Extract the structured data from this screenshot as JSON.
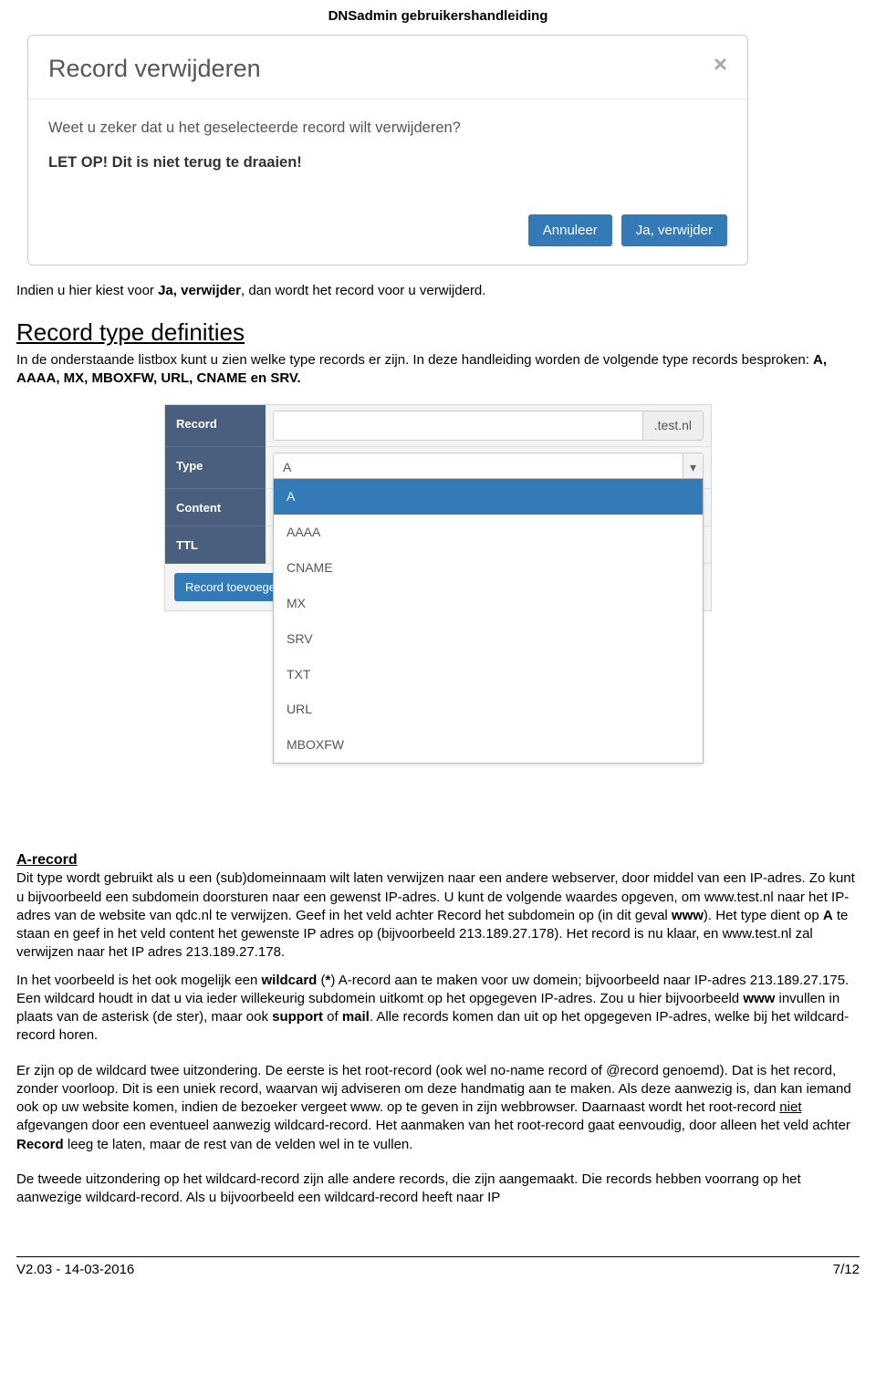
{
  "header": {
    "title": "DNSadmin gebruikershandleiding"
  },
  "modal": {
    "title": "Record verwijderen",
    "close": "×",
    "message": "Weet u zeker dat u het geselecteerde record wilt verwijderen?",
    "warning": "LET OP! Dit is niet terug te draaien!",
    "cancel": "Annuleer",
    "confirm": "Ja, verwijder"
  },
  "text": {
    "after_modal_pre": "Indien u hier kiest voor ",
    "after_modal_bold": "Ja, verwijder",
    "after_modal_post": ", dan wordt het record voor u verwijderd.",
    "section_title": "Record type definities",
    "section_intro_pre": "In de onderstaande listbox kunt u zien welke type records er zijn. In deze handleiding worden de volgende type records besproken: ",
    "section_intro_bold": "A, AAAA, MX, MBOXFW, URL, CNAME en SRV.",
    "a_heading": "A-record",
    "a_p1_a": "Dit type wordt gebruikt als u een (sub)domeinnaam wilt laten verwijzen naar een andere webserver, door middel van een IP-adres. Zo kunt u bijvoorbeeld een subdomein doorsturen naar een gewenst IP-adres. U kunt de volgende waardes opgeven, om www.test.nl naar het IP-adres van de website van qdc.nl te verwijzen. Geef in het veld achter Record het subdomein op (in dit geval ",
    "a_p1_b": "www",
    "a_p1_c": "). Het type dient op ",
    "a_p1_d": "A",
    "a_p1_e": " te staan en geef in het veld content het gewenste IP adres op (bijvoorbeeld 213.189.27.178). Het record is nu klaar, en www.test.nl zal verwijzen naar het IP adres 213.189.27.178.",
    "a_p2_a": "In het voorbeeld is het ook mogelijk een ",
    "a_p2_b": "wildcard",
    "a_p2_c": " (",
    "a_p2_d": "*",
    "a_p2_e": ") A-record aan te maken voor uw domein; bijvoorbeeld naar IP-adres 213.189.27.175. Een wildcard houdt in dat u via ieder willekeurig subdomein uitkomt op het opgegeven IP-adres. Zou u hier bijvoorbeeld ",
    "a_p2_f": "www",
    "a_p2_g": " invullen in plaats van de asterisk (de ster), maar ook ",
    "a_p2_h": "support",
    "a_p2_i": " of ",
    "a_p2_j": "mail",
    "a_p2_k": ". Alle records komen dan uit op het opgegeven IP-adres, welke bij het wildcard-record horen.",
    "a_p3_a": "Er zijn op de wildcard twee uitzondering. De eerste is het root-record (ook wel no-name record of @record genoemd). Dat is het record, zonder voorloop. Dit is een uniek record, waarvan wij adviseren om deze handmatig aan te maken. Als deze aanwezig is, dan kan iemand ook op uw website komen, indien de bezoeker vergeet www. op te geven in zijn webbrowser. Daarnaast wordt het root-record ",
    "a_p3_b": "niet",
    "a_p3_c": " afgevangen door een eventueel aanwezig wildcard-record. Het aanmaken van het root-record gaat eenvoudig, door alleen het veld achter ",
    "a_p3_d": "Record",
    "a_p3_e": " leeg te laten, maar de rest van de velden wel in te vullen.",
    "a_p4": "De tweede uitzondering op het wildcard-record zijn alle andere records, die zijn aangemaakt. Die records hebben voorrang op het aanwezige wildcard-record. Als u bijvoorbeeld een wildcard-record heeft naar IP"
  },
  "form": {
    "labels": {
      "record": "Record",
      "type": "Type",
      "content": "Content",
      "ttl": "TTL"
    },
    "record_value": "",
    "record_suffix": ".test.nl",
    "type_value": "A",
    "caret": "▾",
    "options": [
      "A",
      "AAAA",
      "CNAME",
      "MX",
      "SRV",
      "TXT",
      "URL",
      "MBOXFW"
    ],
    "add_button": "Record toevoegen"
  },
  "footer": {
    "left": "V2.03 - 14-03-2016",
    "right": "7/12"
  }
}
